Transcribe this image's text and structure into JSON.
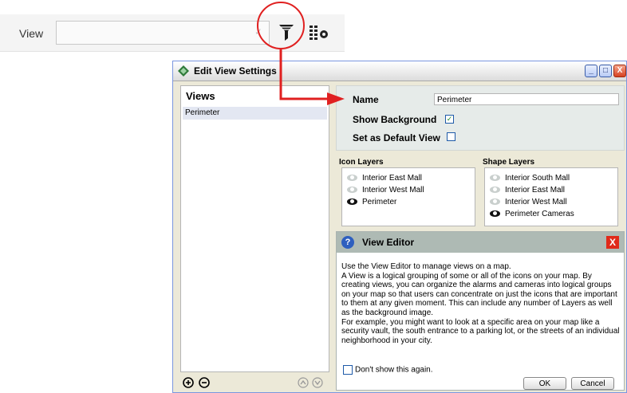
{
  "toolbar": {
    "view_label": "View",
    "view_value": "",
    "icons": [
      "view-filter-icon",
      "layers-settings-icon"
    ]
  },
  "dialog": {
    "title": "Edit View Settings",
    "window_buttons": {
      "minimize": "_",
      "maximize": "□",
      "close": "X"
    },
    "views_header": "Views",
    "views": [
      "Perimeter"
    ],
    "name_label": "Name",
    "name_value": "Perimeter",
    "show_background_label": "Show Background",
    "show_background_checked": true,
    "default_view_label": "Set as Default View",
    "default_view_checked": false,
    "icon_layers_header": "Icon Layers",
    "icon_layers": [
      {
        "label": "Interior East Mall",
        "visible": false
      },
      {
        "label": "Interior West Mall",
        "visible": false
      },
      {
        "label": "Perimeter",
        "visible": true
      }
    ],
    "shape_layers_header": "Shape Layers",
    "shape_layers": [
      {
        "label": "Interior South Mall",
        "visible": false
      },
      {
        "label": "Interior East Mall",
        "visible": false
      },
      {
        "label": "Interior West Mall",
        "visible": false
      },
      {
        "label": "Perimeter Cameras",
        "visible": true
      }
    ],
    "editor": {
      "title": "View Editor",
      "close": "X",
      "paragraphs": [
        "Use the View Editor to manage views on a map.",
        "A View is a logical grouping of some or all of the icons on your map. By creating views, you can organize the alarms and cameras into logical groups on your map so that users can concentrate on just the icons that are important to them at any given moment. This can include any number of Layers as well as the background image.",
        "For example, you might want to look at a specific area on your map like a security vault, the south entrance to a parking lot, or the streets of an individual neighborhood in your city."
      ],
      "dont_show_label": "Don't show this again.",
      "ok_label": "OK",
      "cancel_label": "Cancel"
    }
  },
  "colors": {
    "highlight": "#e02020",
    "editor_header": "#aebab4",
    "settings_panel": "#e6ebe9"
  }
}
